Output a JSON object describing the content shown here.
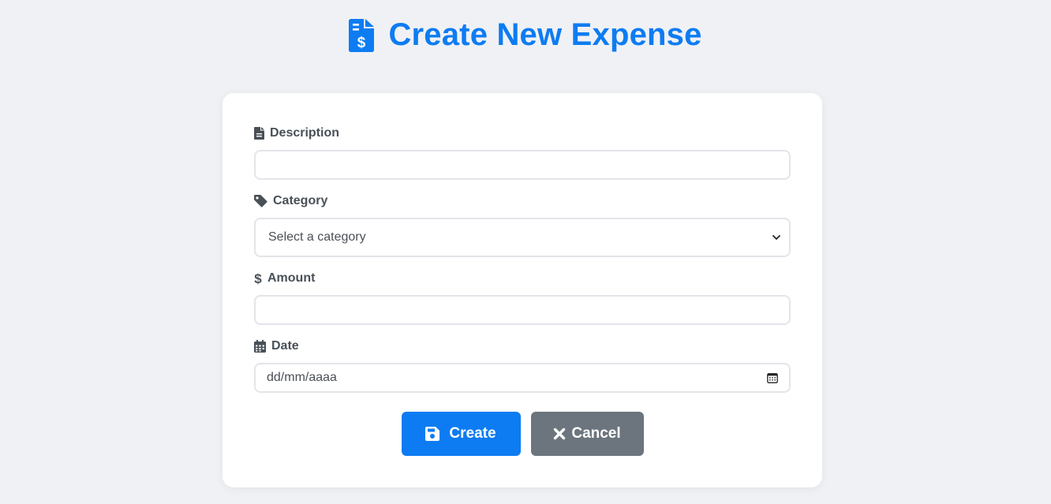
{
  "header": {
    "title": "Create New Expense",
    "icon": "file-invoice-dollar-icon",
    "color": "#0d7cf2"
  },
  "form": {
    "description": {
      "label": "Description",
      "icon": "file-icon",
      "value": ""
    },
    "category": {
      "label": "Category",
      "icon": "tag-icon",
      "selected": "Select a category"
    },
    "amount": {
      "label": "Amount",
      "icon": "dollar-icon",
      "value": ""
    },
    "date": {
      "label": "Date",
      "icon": "calendar-icon",
      "placeholder": "dd/mm/aaaa"
    }
  },
  "actions": {
    "create_label": "Create",
    "create_icon": "save-icon",
    "create_color": "#0d7cf2",
    "cancel_label": "Cancel",
    "cancel_icon": "times-icon",
    "cancel_color": "#6c757d"
  }
}
